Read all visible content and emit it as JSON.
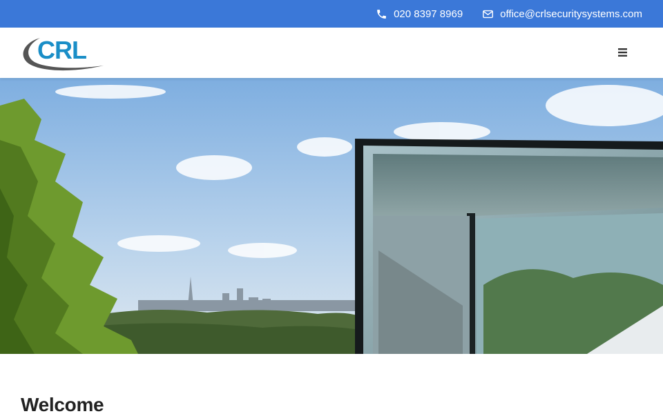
{
  "topbar": {
    "phone": {
      "icon": "phone-icon",
      "text": "020 8397 8969"
    },
    "email": {
      "icon": "envelope-icon",
      "text": "office@crlsecuritysystems.com"
    },
    "background_color": "#3b78d8"
  },
  "header": {
    "logo_text": "CRL",
    "logo_colors": {
      "text": "#1a8ec7",
      "swoosh": "#555555"
    },
    "menu_icon": "hamburger-menu-icon"
  },
  "hero": {
    "image_description_icon": "hero-photo"
  },
  "main": {
    "heading": "Welcome"
  }
}
